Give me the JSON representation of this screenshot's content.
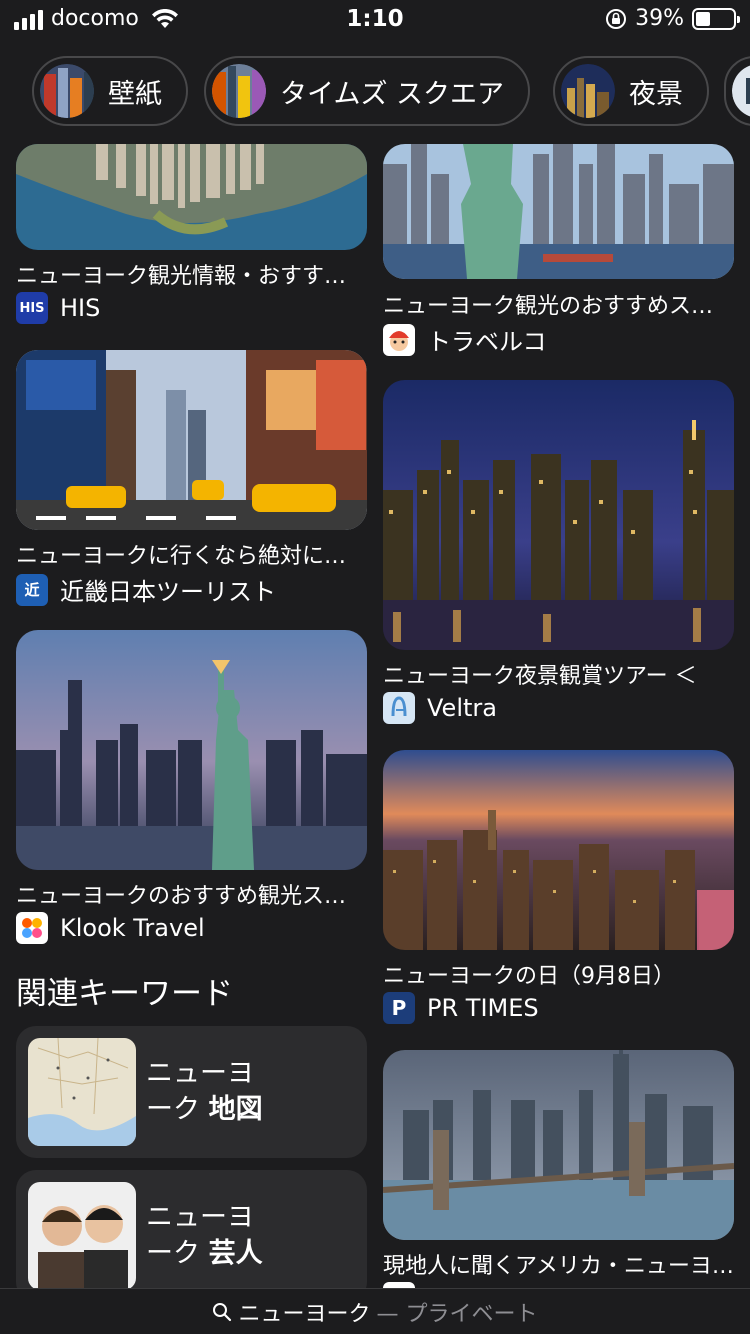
{
  "status_bar": {
    "carrier": "docomo",
    "time": "1:10",
    "battery": "39%",
    "battery_level": 0.39
  },
  "chips": [
    {
      "label": "壁紙",
      "thumb_icon": "wallpaper-thumb"
    },
    {
      "label": "タイムズ スクエア",
      "thumb_icon": "times-square-thumb"
    },
    {
      "label": "夜景",
      "thumb_icon": "night-view-thumb"
    }
  ],
  "left_column": [
    {
      "title": "ニューヨーク観光情報・おすすめ観光スポット",
      "source": "HIS",
      "favicon": "HIS",
      "favicon_color": "#1f3ca8"
    },
    {
      "title": "ニューヨークに行くなら絶対に行きたい",
      "source": "近畿日本ツーリスト",
      "favicon": "近",
      "favicon_color": "#1e5fb4"
    },
    {
      "title": "ニューヨークのおすすめ観光スポット",
      "source": "Klook Travel",
      "favicon": "",
      "favicon_color": "#ffffff"
    }
  ],
  "right_column": [
    {
      "title": "ニューヨーク観光のおすすめスポット",
      "source": "トラベルコ",
      "favicon": "",
      "favicon_color": "#ffffff"
    },
    {
      "title": "ニューヨーク夜景観賞ツアー ＜",
      "source": "Veltra",
      "favicon": "",
      "favicon_color": "#d6e6f5"
    },
    {
      "title": "ニューヨークの日（9月8日）",
      "source": "PR TIMES",
      "favicon": "P",
      "favicon_color": "#1c3d7a"
    },
    {
      "title": "現地人に聞くアメリカ・ニューヨーク",
      "source": "",
      "favicon": "",
      "favicon_color": "#ffffff"
    }
  ],
  "related": {
    "heading": "関連キーワード",
    "items": [
      {
        "line1": "ニューヨ",
        "line2_prefix": "ーク ",
        "line2_bold": "地図"
      },
      {
        "line1": "ニューヨ",
        "line2_prefix": "ーク ",
        "line2_bold": "芸人"
      }
    ]
  },
  "bottom_bar": {
    "query": "ニューヨーク",
    "mode": "— プライベート"
  }
}
